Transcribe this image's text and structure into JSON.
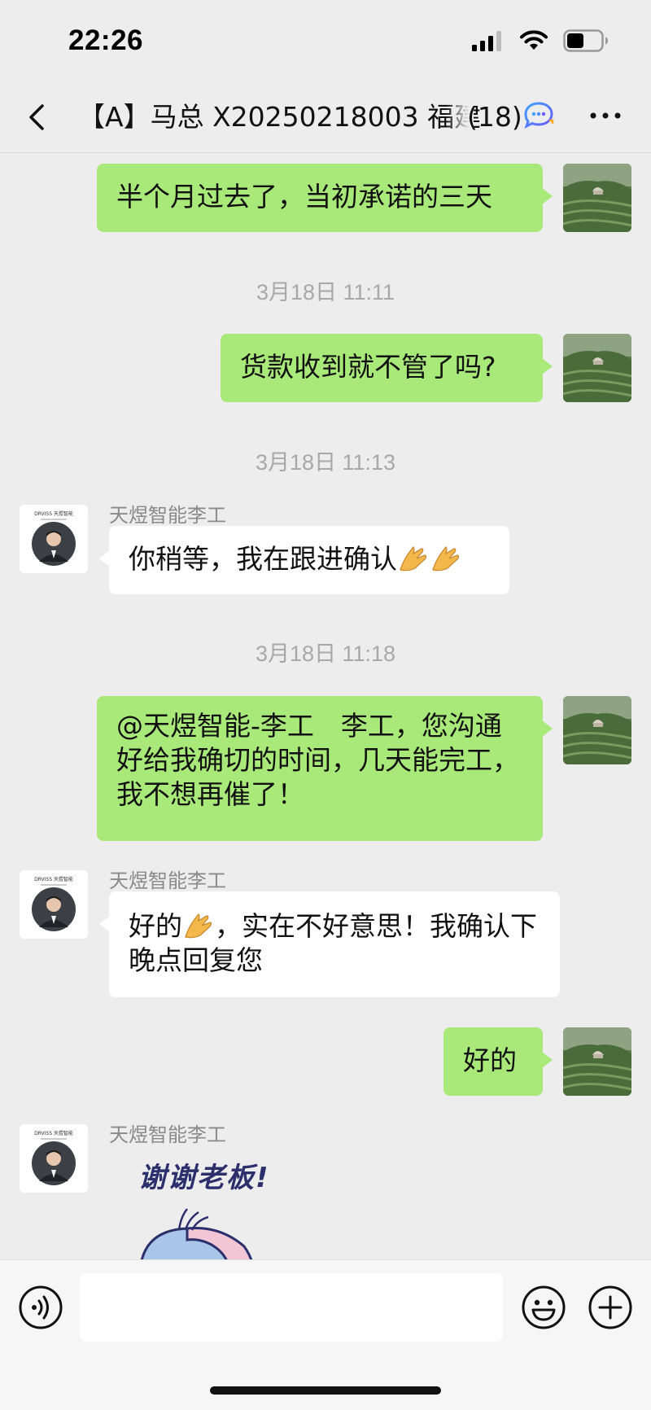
{
  "status_bar": {
    "time": "22:26"
  },
  "nav": {
    "title": "【A】马总 X20250218003 福建",
    "member_count": "(18)"
  },
  "messages": [
    {
      "type": "text",
      "from": "self",
      "text": "半个月过去了，当初承诺的三天"
    },
    {
      "type": "timestamp",
      "text": "3月18日 11:11"
    },
    {
      "type": "text",
      "from": "self",
      "text": "货款收到就不管了吗?"
    },
    {
      "type": "timestamp",
      "text": "3月18日 11:13"
    },
    {
      "type": "text",
      "from": "other",
      "sender": "天煜智能李工",
      "text": "你稍等，我在跟进确认",
      "trailing_emoji": [
        "pray",
        "pray"
      ]
    },
    {
      "type": "timestamp",
      "text": "3月18日 11:18"
    },
    {
      "type": "text",
      "from": "self",
      "text": "@天煜智能-李工 李工，您沟通好给我确切的时间，几天能完工，我不想再催了！"
    },
    {
      "type": "text",
      "from": "other",
      "sender": "天煜智能李工",
      "text_before_emoji": "好的",
      "inline_emoji": "pray",
      "text": "，实在不好意思！我确认下晚点回复您"
    },
    {
      "type": "text",
      "from": "self",
      "text": "好的"
    },
    {
      "type": "sticker",
      "from": "other",
      "sender": "天煜智能李工",
      "caption": "谢谢老板!"
    }
  ],
  "avatar_self": {
    "kind": "landscape photo with hilltop house"
  },
  "avatar_other": {
    "kind": "company logo with portrait",
    "logo_text": "DRVISS 天煜智能"
  },
  "input_bar": {
    "value": "",
    "placeholder": ""
  },
  "colors": {
    "background": "#ededed",
    "self_bubble": "#a9e97a",
    "other_bubble": "#ffffff",
    "timestamp_text": "#a8a8a8",
    "sender_text": "#8a8a8a"
  },
  "icons": [
    "back-chevron-icon",
    "chat-bubble-icon",
    "more-icon",
    "signal-icon",
    "wifi-icon",
    "battery-icon",
    "voice-icon",
    "emoji-icon",
    "plus-icon",
    "pray-hands-emoji"
  ]
}
